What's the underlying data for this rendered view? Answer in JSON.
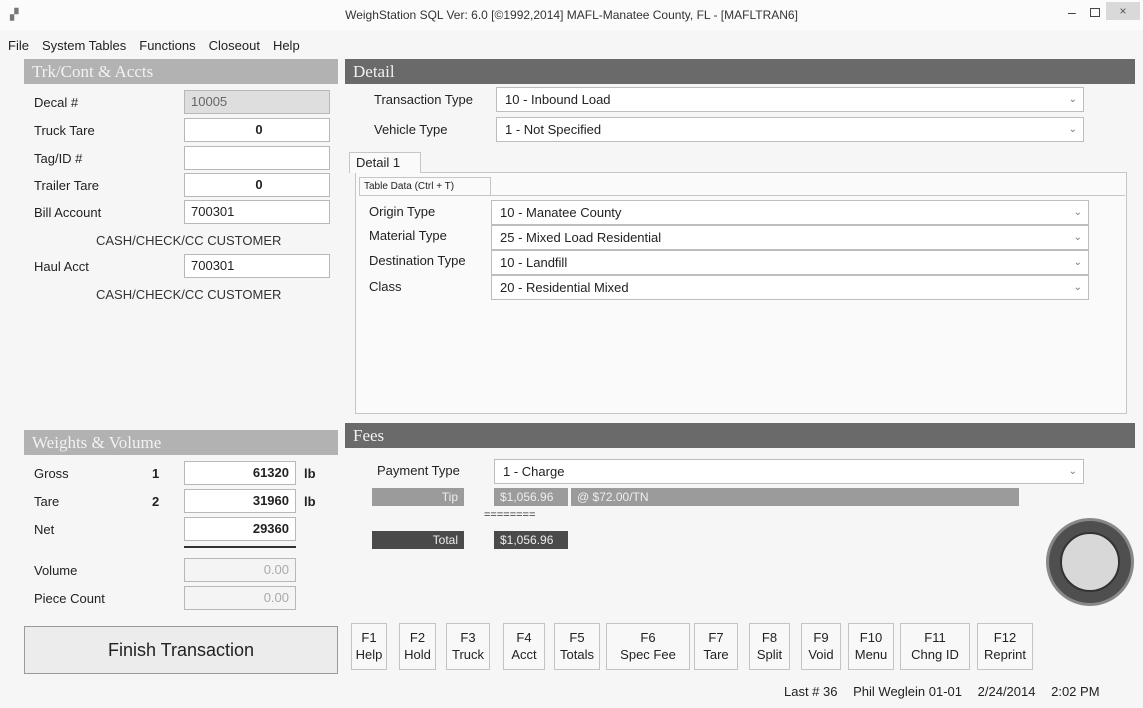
{
  "window": {
    "title": "WeighStation  SQL  Ver: 6.0 [©1992,2014]  MAFL-Manatee County, FL - [MAFLTRAN6]",
    "minimize": "–",
    "close": "×"
  },
  "menu": [
    "File",
    "System Tables",
    "Functions",
    "Closeout",
    "Help"
  ],
  "left_panel": {
    "title": "Trk/Cont & Accts",
    "decal_label": "Decal #",
    "decal_value": "10005",
    "truck_tare_label": "Truck Tare",
    "truck_tare_value": "0",
    "tag_label": "Tag/ID #",
    "tag_value": "",
    "trailer_tare_label": "Trailer Tare",
    "trailer_tare_value": "0",
    "bill_account_label": "Bill Account",
    "bill_account_value": "700301",
    "bill_customer": "CASH/CHECK/CC CUSTOMER",
    "haul_account_label": "Haul Acct",
    "haul_account_value": "700301",
    "haul_customer": "CASH/CHECK/CC CUSTOMER"
  },
  "detail": {
    "title": "Detail",
    "transaction_type_label": "Transaction Type",
    "transaction_type_value": "10 - Inbound Load",
    "vehicle_type_label": "Vehicle Type",
    "vehicle_type_value": "1 - Not Specified",
    "tab_label": "Detail 1",
    "table_data_label": "Table Data (Ctrl + T)",
    "origin_label": "Origin Type",
    "origin_value": "10 - Manatee County",
    "material_label": "Material Type",
    "material_value": "25 - Mixed Load Residential",
    "destination_label": "Destination Type",
    "destination_value": "10 - Landfill",
    "class_label": "Class",
    "class_value": "20 - Residential Mixed"
  },
  "weights": {
    "title": "Weights & Volume",
    "gross_label": "Gross",
    "gross_scale": "1",
    "gross_value": "61320",
    "gross_unit": "lb",
    "tare_label": "Tare",
    "tare_scale": "2",
    "tare_value": "31960",
    "tare_unit": "lb",
    "net_label": "Net",
    "net_value": "29360",
    "volume_label": "Volume",
    "volume_value": "0.00",
    "piece_label": "Piece Count",
    "piece_value": "0.00"
  },
  "fees": {
    "title": "Fees",
    "payment_label": "Payment Type",
    "payment_value": "1 - Charge",
    "tip_label": "Tip",
    "tip_amount": "$1,056.96",
    "tip_rate": "@ $72.00/TN",
    "separator": "========",
    "total_label": "Total",
    "total_amount": "$1,056.96"
  },
  "finish_button": "Finish Transaction",
  "fkeys": [
    {
      "key": "F1",
      "label": "Help"
    },
    {
      "key": "F2",
      "label": "Hold"
    },
    {
      "key": "F3",
      "label": "Truck"
    },
    {
      "key": "F4",
      "label": "Acct"
    },
    {
      "key": "F5",
      "label": "Totals"
    },
    {
      "key": "F6",
      "label": "Spec Fee"
    },
    {
      "key": "F7",
      "label": "Tare"
    },
    {
      "key": "F8",
      "label": "Split"
    },
    {
      "key": "F9",
      "label": "Void"
    },
    {
      "key": "F10",
      "label": "Menu"
    },
    {
      "key": "F11",
      "label": "Chng ID"
    },
    {
      "key": "F12",
      "label": "Reprint"
    }
  ],
  "status": {
    "last": "Last # 36",
    "user": "Phil Weglein  01-01",
    "date": "2/24/2014",
    "time": "2:02 PM"
  }
}
